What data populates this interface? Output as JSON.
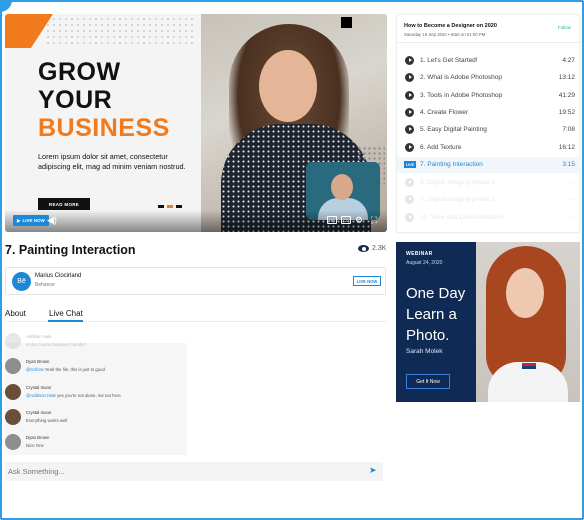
{
  "video": {
    "headline": [
      "GROW",
      "YOUR",
      "BUSINESS"
    ],
    "lorem": "Lorem ipsum dolor sit amet, consectetur adipiscing elit, mag ad minim veniam nostrud.",
    "read_more": "READ MORE",
    "live_label": "LIVE NOW"
  },
  "title": "7. Painting Interaction",
  "views": "2.3K",
  "channel": {
    "name": "Marius Ciocirland",
    "subtitle": "Behance",
    "live_button": "LIVE NOW"
  },
  "tabs": {
    "about": "About",
    "live_chat": "Live Chat"
  },
  "chat": [
    {
      "name": "Addison Hale",
      "text": "Is this course beginner friendly?",
      "faded": true
    },
    {
      "name": "Dyan Brown",
      "mention": "@Grifora",
      "text": "Yeah the file, this is just to good",
      "faded": false
    },
    {
      "name": "Crystal moon",
      "mention": "@Addison Hale",
      "text": "yes you're not alone, me too here",
      "faded": false
    },
    {
      "name": "Crystal moon",
      "mention": "",
      "text": "Everything works well",
      "faded": false
    },
    {
      "name": "Dyan Brown",
      "mention": "",
      "text": "Nice One",
      "faded": false
    }
  ],
  "ask": {
    "placeholder": "Ask Something..."
  },
  "playlist": {
    "title": "How to Become a Designer on 2020",
    "subtitle": "Saturday 18 Sep 2020  •  Start on 01:00 PM",
    "follow": "Follow",
    "items": [
      {
        "label": "1. Let's Get Started!",
        "duration": "4:27"
      },
      {
        "label": "2. What is Adobe Photoshop",
        "duration": "13:12"
      },
      {
        "label": "3. Tools in Adobe Photoshop",
        "duration": "41:29"
      },
      {
        "label": "4. Create Flower",
        "duration": "19:52"
      },
      {
        "label": "5. Easy Digital Painting",
        "duration": "7:08"
      },
      {
        "label": "6. Add Texture",
        "duration": "16:12"
      },
      {
        "label": "7. Painting Interaction",
        "duration": "3:15",
        "live": "LIVE"
      },
      {
        "label": "8. Digital Imaging phase 1",
        "duration": "-:--"
      },
      {
        "label": "9. Digital Imaging phase 2",
        "duration": "-:--"
      },
      {
        "label": "10. Slow and Documentation",
        "duration": "-:--"
      }
    ]
  },
  "ad": {
    "kicker": "WEBINAR",
    "date": "August 24, 2020",
    "title": [
      "One Day",
      "Learn a",
      "Photo."
    ],
    "author": "Sarah Molek",
    "button": "Get It Now"
  },
  "colors": {
    "accent": "#1e88d8",
    "brand_orange": "#f07a1c",
    "ad_navy": "#0f2a55",
    "follow_green": "#2bb673"
  }
}
